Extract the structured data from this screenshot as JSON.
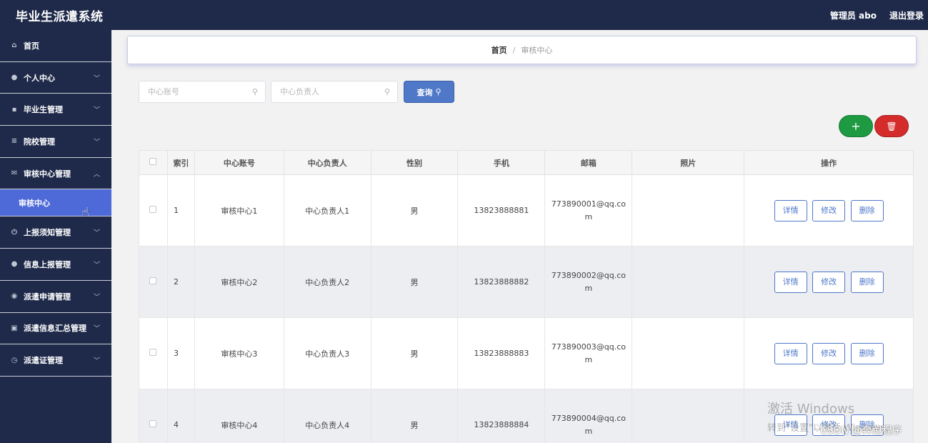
{
  "app": {
    "title": "毕业生派遣系统"
  },
  "topbar": {
    "user": "管理员 abo",
    "logout": "退出登录"
  },
  "sidebar": {
    "items": [
      {
        "label": "首页",
        "icon": "home-icon",
        "glyph": "⌂"
      },
      {
        "label": "个人中心",
        "icon": "user-icon",
        "glyph": "●"
      },
      {
        "label": "毕业生管理",
        "icon": "briefcase-icon",
        "glyph": "▪"
      },
      {
        "label": "院校管理",
        "icon": "list-icon",
        "glyph": "≡"
      },
      {
        "label": "审核中心管理",
        "icon": "mail-icon",
        "glyph": "✉"
      },
      {
        "label": "上报须知管理",
        "icon": "power-icon",
        "glyph": "⏻"
      },
      {
        "label": "信息上报管理",
        "icon": "person-icon",
        "glyph": "●"
      },
      {
        "label": "派遣申请管理",
        "icon": "location-icon",
        "glyph": "◉"
      },
      {
        "label": "派遣信息汇总管理",
        "icon": "clipboard-icon",
        "glyph": "▣"
      },
      {
        "label": "派遣证管理",
        "icon": "clock-icon",
        "glyph": "◷"
      }
    ],
    "active_sub": "审核中心"
  },
  "breadcrumb": {
    "home": "首页",
    "separator": "/",
    "current": "审核中心"
  },
  "search": {
    "account_placeholder": "中心账号",
    "manager_placeholder": "中心负责人",
    "query_label": "查询"
  },
  "table": {
    "headers": [
      "索引",
      "中心账号",
      "中心负责人",
      "性别",
      "手机",
      "邮箱",
      "照片",
      "操作"
    ],
    "actions": {
      "detail": "详情",
      "edit": "修改",
      "delete": "删除"
    },
    "rows": [
      {
        "index": "1",
        "account": "审核中心1",
        "manager": "中心负责人1",
        "gender": "男",
        "phone": "13823888881",
        "email": "773890001@qq.com"
      },
      {
        "index": "2",
        "account": "审核中心2",
        "manager": "中心负责人2",
        "gender": "男",
        "phone": "13823888882",
        "email": "773890002@qq.com"
      },
      {
        "index": "3",
        "account": "审核中心3",
        "manager": "中心负责人3",
        "gender": "男",
        "phone": "13823888883",
        "email": "773890003@qq.com"
      },
      {
        "index": "4",
        "account": "审核中心4",
        "manager": "中心负责人4",
        "gender": "男",
        "phone": "13823888884",
        "email": "773890004@qq.com"
      }
    ]
  },
  "watermark": {
    "line1": "激活 Windows",
    "line2": "转到\"设置\"以激活 Windows。",
    "csdn": "CSDN @奔跑程序"
  },
  "colors": {
    "nav_bg": "#1f2a4a",
    "active": "#4e6ad8",
    "primary": "#4f78c9",
    "add": "#1e9a43",
    "danger": "#d42b2b"
  }
}
